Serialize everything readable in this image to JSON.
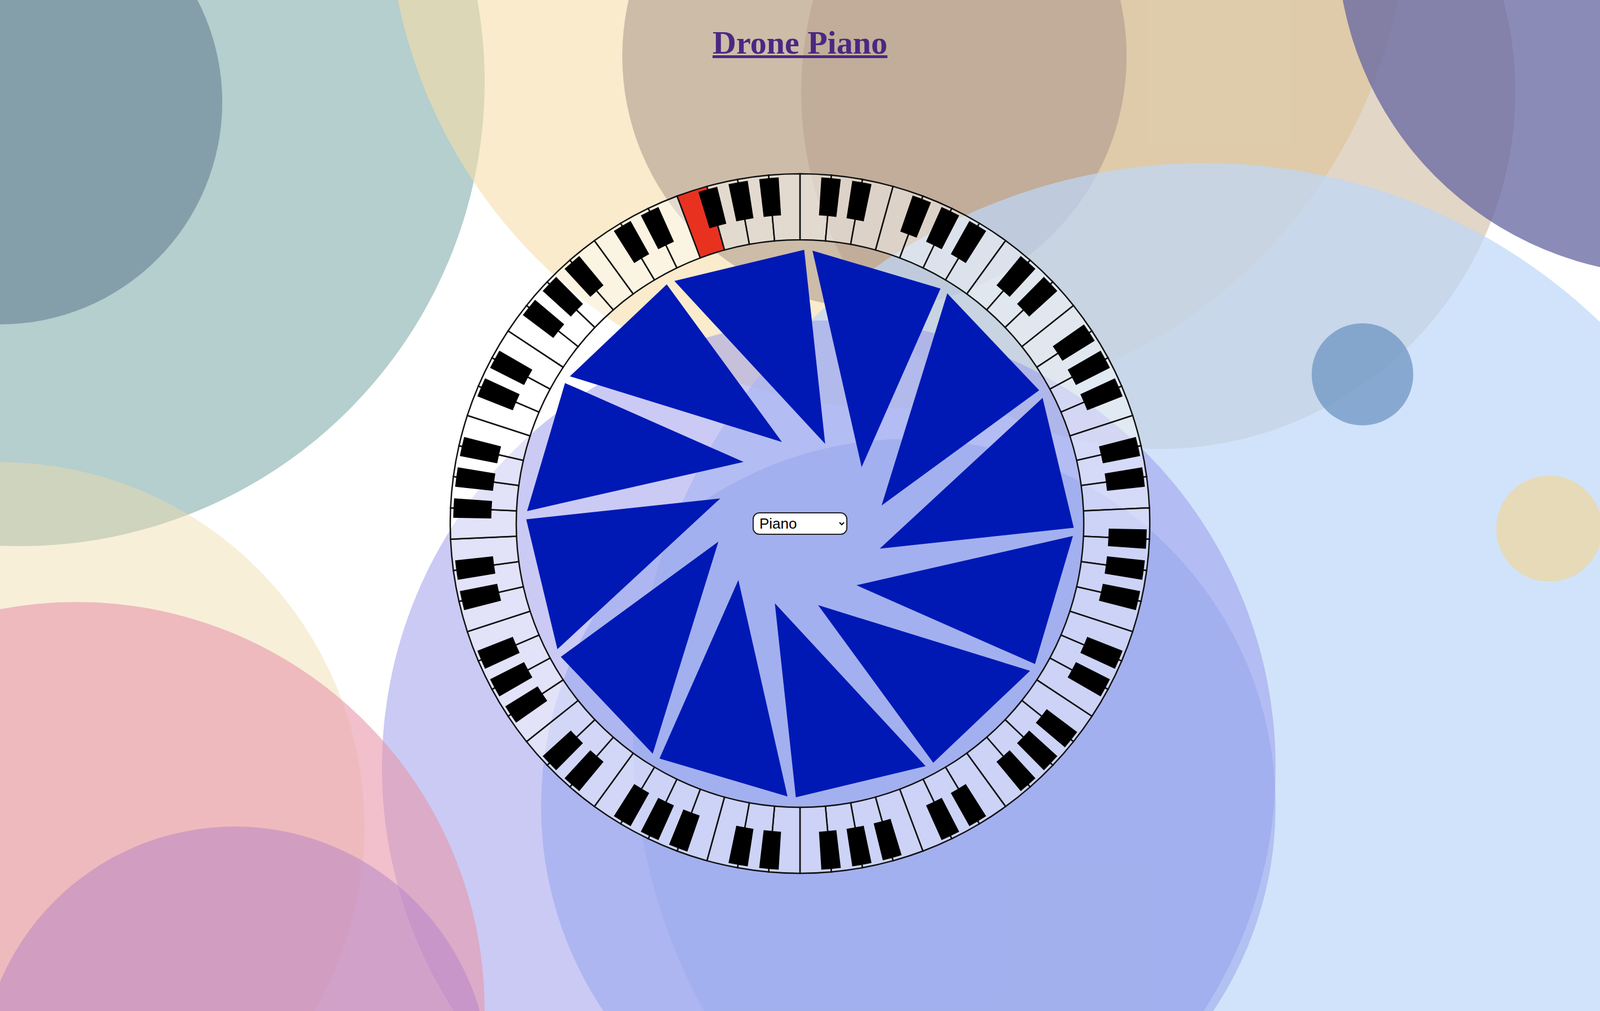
{
  "title": {
    "text": "Drone Piano"
  },
  "instrument": {
    "value": "Piano"
  },
  "keys": [
    {
      "kind": "white",
      "pressed": false
    },
    {
      "kind": "black",
      "pressed": false
    },
    {
      "kind": "white",
      "pressed": false
    },
    {
      "kind": "black",
      "pressed": false
    },
    {
      "kind": "white",
      "pressed": false
    },
    {
      "kind": "white",
      "pressed": false
    },
    {
      "kind": "black",
      "pressed": false
    },
    {
      "kind": "white",
      "pressed": false
    },
    {
      "kind": "black",
      "pressed": false
    },
    {
      "kind": "white",
      "pressed": false
    },
    {
      "kind": "black",
      "pressed": false
    },
    {
      "kind": "white",
      "pressed": false
    },
    {
      "kind": "white",
      "pressed": false
    },
    {
      "kind": "black",
      "pressed": false
    },
    {
      "kind": "white",
      "pressed": false
    },
    {
      "kind": "black",
      "pressed": false
    },
    {
      "kind": "white",
      "pressed": false
    },
    {
      "kind": "white",
      "pressed": false
    },
    {
      "kind": "black",
      "pressed": false
    },
    {
      "kind": "white",
      "pressed": false
    },
    {
      "kind": "black",
      "pressed": false
    },
    {
      "kind": "white",
      "pressed": false
    },
    {
      "kind": "black",
      "pressed": false
    },
    {
      "kind": "white",
      "pressed": false
    },
    {
      "kind": "white",
      "pressed": false
    },
    {
      "kind": "black",
      "pressed": false
    },
    {
      "kind": "white",
      "pressed": false
    },
    {
      "kind": "black",
      "pressed": false
    },
    {
      "kind": "white",
      "pressed": false
    },
    {
      "kind": "white",
      "pressed": false
    },
    {
      "kind": "black",
      "pressed": false
    },
    {
      "kind": "white",
      "pressed": false
    },
    {
      "kind": "black",
      "pressed": false
    },
    {
      "kind": "white",
      "pressed": false
    },
    {
      "kind": "black",
      "pressed": false
    },
    {
      "kind": "white",
      "pressed": false
    },
    {
      "kind": "white",
      "pressed": false
    },
    {
      "kind": "black",
      "pressed": false
    },
    {
      "kind": "white",
      "pressed": false
    },
    {
      "kind": "black",
      "pressed": false
    },
    {
      "kind": "white",
      "pressed": false
    },
    {
      "kind": "white",
      "pressed": false
    },
    {
      "kind": "black",
      "pressed": false
    },
    {
      "kind": "white",
      "pressed": false
    },
    {
      "kind": "black",
      "pressed": false
    },
    {
      "kind": "white",
      "pressed": false
    },
    {
      "kind": "black",
      "pressed": false
    },
    {
      "kind": "white",
      "pressed": false
    },
    {
      "kind": "white",
      "pressed": false
    },
    {
      "kind": "black",
      "pressed": false
    },
    {
      "kind": "white",
      "pressed": false
    },
    {
      "kind": "black",
      "pressed": false
    },
    {
      "kind": "white",
      "pressed": false
    },
    {
      "kind": "white",
      "pressed": false
    },
    {
      "kind": "black",
      "pressed": false
    },
    {
      "kind": "white",
      "pressed": false
    },
    {
      "kind": "black",
      "pressed": false
    },
    {
      "kind": "white",
      "pressed": false
    },
    {
      "kind": "black",
      "pressed": false
    },
    {
      "kind": "white",
      "pressed": false
    },
    {
      "kind": "white",
      "pressed": false
    },
    {
      "kind": "black",
      "pressed": false
    },
    {
      "kind": "white",
      "pressed": false
    },
    {
      "kind": "black",
      "pressed": false
    },
    {
      "kind": "white",
      "pressed": false
    },
    {
      "kind": "white",
      "pressed": false
    },
    {
      "kind": "black",
      "pressed": false
    },
    {
      "kind": "white",
      "pressed": false
    },
    {
      "kind": "black",
      "pressed": false
    },
    {
      "kind": "white",
      "pressed": false
    },
    {
      "kind": "black",
      "pressed": false
    },
    {
      "kind": "white",
      "pressed": false
    },
    {
      "kind": "white",
      "pressed": false
    },
    {
      "kind": "black",
      "pressed": false
    },
    {
      "kind": "white",
      "pressed": false
    },
    {
      "kind": "black",
      "pressed": false
    },
    {
      "kind": "white",
      "pressed": false
    },
    {
      "kind": "white",
      "pressed": false
    },
    {
      "kind": "black",
      "pressed": false
    },
    {
      "kind": "white",
      "pressed": false
    },
    {
      "kind": "black",
      "pressed": false
    },
    {
      "kind": "white",
      "pressed": false
    },
    {
      "kind": "black",
      "pressed": false
    },
    {
      "kind": "white",
      "pressed": false
    },
    {
      "kind": "white",
      "pressed": false
    },
    {
      "kind": "black",
      "pressed": false
    },
    {
      "kind": "white",
      "pressed": false
    },
    {
      "kind": "black",
      "pressed": false
    },
    {
      "kind": "white",
      "pressed": false
    },
    {
      "kind": "white",
      "pressed": false
    },
    {
      "kind": "black",
      "pressed": false
    },
    {
      "kind": "white",
      "pressed": false
    },
    {
      "kind": "black",
      "pressed": false
    },
    {
      "kind": "white",
      "pressed": false
    },
    {
      "kind": "black",
      "pressed": false
    },
    {
      "kind": "white",
      "pressed": false
    },
    {
      "kind": "white",
      "pressed": false
    },
    {
      "kind": "black",
      "pressed": false
    },
    {
      "kind": "white",
      "pressed": false
    },
    {
      "kind": "black",
      "pressed": false
    },
    {
      "kind": "white",
      "pressed": false
    },
    {
      "kind": "white",
      "pressed": false
    },
    {
      "kind": "black",
      "pressed": false
    },
    {
      "kind": "white",
      "pressed": false
    },
    {
      "kind": "black",
      "pressed": false
    },
    {
      "kind": "white",
      "pressed": false
    },
    {
      "kind": "black",
      "pressed": false
    },
    {
      "kind": "white",
      "pressed": false
    },
    {
      "kind": "white",
      "pressed": false
    },
    {
      "kind": "black",
      "pressed": false
    },
    {
      "kind": "white",
      "pressed": false
    },
    {
      "kind": "black",
      "pressed": false
    },
    {
      "kind": "white",
      "pressed": false
    },
    {
      "kind": "white",
      "pressed": true
    },
    {
      "kind": "black",
      "pressed": false
    },
    {
      "kind": "white",
      "pressed": false
    },
    {
      "kind": "black",
      "pressed": false
    },
    {
      "kind": "white",
      "pressed": false
    },
    {
      "kind": "black",
      "pressed": false
    },
    {
      "kind": "white",
      "pressed": false
    }
  ]
}
